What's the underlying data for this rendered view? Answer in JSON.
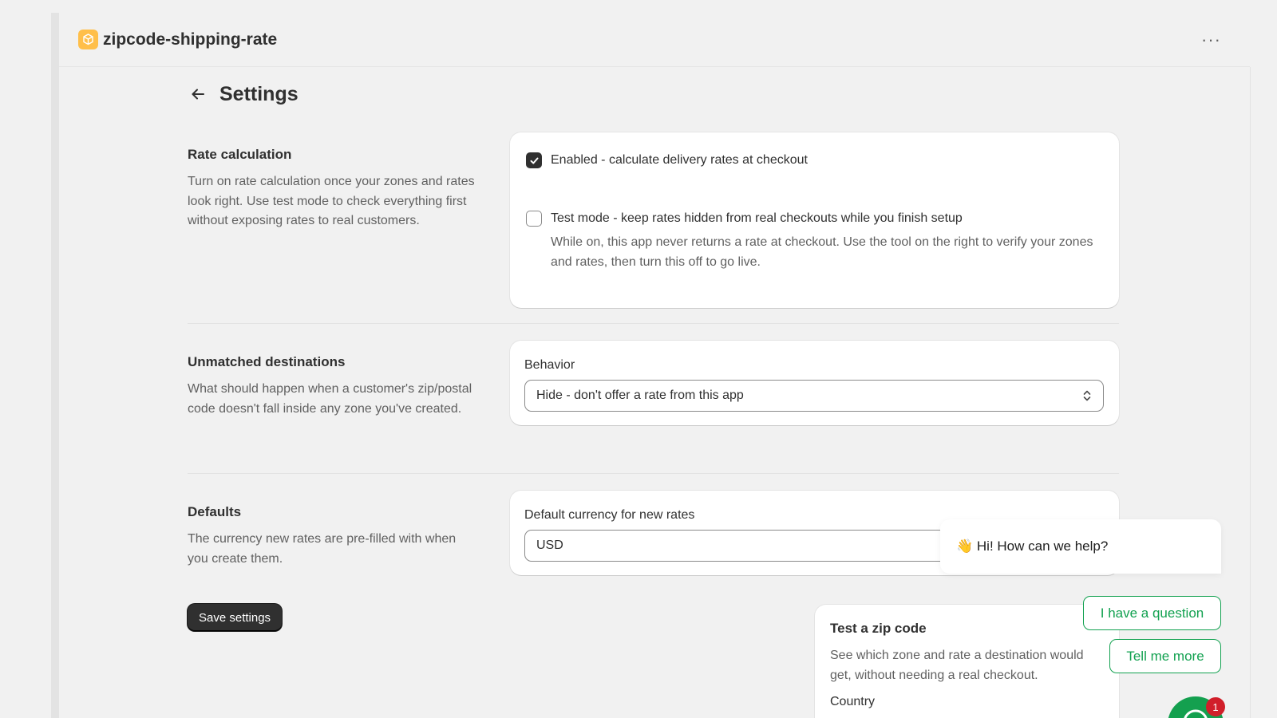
{
  "app": {
    "title": "zipcode-shipping-rate",
    "more_label": "···"
  },
  "page": {
    "title": "Settings"
  },
  "sections": {
    "rate_calculation": {
      "heading": "Rate calculation",
      "description": "Turn on rate calculation once your zones and rates look right. Use test mode to check everything first without exposing rates to real customers.",
      "enabled": {
        "label": "Enabled - calculate delivery rates at checkout",
        "checked": true
      },
      "test_mode": {
        "label": "Test mode - keep rates hidden from real checkouts while you finish setup",
        "help": "While on, this app never returns a rate at checkout. Use the tool on the right to verify your zones and rates, then turn this off to go live.",
        "checked": false
      }
    },
    "unmatched": {
      "heading": "Unmatched destinations",
      "description": "What should happen when a customer's zip/postal code doesn't fall inside any zone you've created.",
      "field_label": "Behavior",
      "selected": "Hide - don't offer a rate from this app"
    },
    "defaults": {
      "heading": "Defaults",
      "description": "The currency new rates are pre-filled with when you create them.",
      "field_label": "Default currency for new rates",
      "value": "USD"
    }
  },
  "save_button": "Save settings",
  "test_zip": {
    "title": "Test a zip code",
    "description": "See which zone and rate a destination would get, without needing a real checkout.",
    "country_label": "Country"
  },
  "chat": {
    "greeting": "👋 Hi! How can we help?",
    "question_button": "I have a question",
    "more_button": "Tell me more",
    "badge_count": "1"
  },
  "colors": {
    "brand_logo": "#ffbf4a",
    "primary_button": "#303030",
    "chat_accent": "#12a150",
    "badge": "#d11f2a"
  }
}
